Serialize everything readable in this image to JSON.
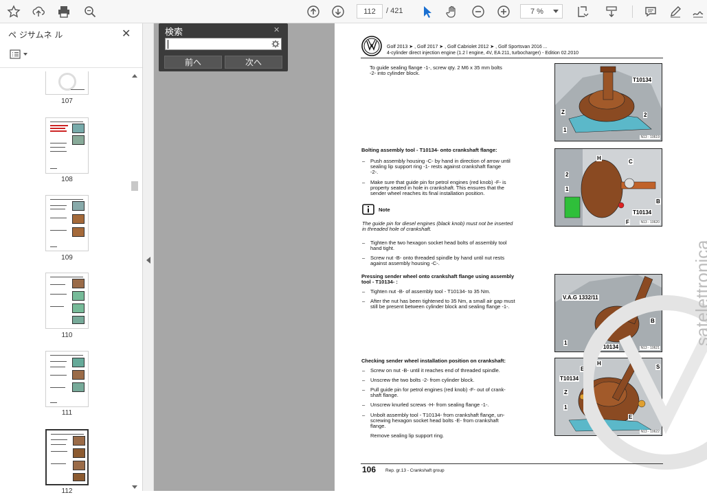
{
  "toolbar": {
    "page_current": "112",
    "page_total": "/ 421",
    "zoom": "7 %"
  },
  "sidebar": {
    "title": "ペ ジサムネ ル",
    "thumbnails": [
      {
        "label": "107"
      },
      {
        "label": "108"
      },
      {
        "label": "109"
      },
      {
        "label": "110"
      },
      {
        "label": "111"
      },
      {
        "label": "112"
      }
    ]
  },
  "search": {
    "title": "検索",
    "prev_label": "前へ",
    "next_label": "次へ",
    "input_value": ""
  },
  "document": {
    "header_line1": "Golf 2013 ➤ , Golf 2017 ➤ , Golf Cabriolet 2012 ➤ , Golf Sportsvan 2016 ...",
    "header_line2": "4-cylinder direct injection engine (1.2 l engine, 4V, EA 211, turbocharger) - Edition 02.2010",
    "s1_line1": "To guide sealing flange -1-, screw qty. 2 M6 x 35 mm bolts",
    "s1_line2": "-2- into cylinder block.",
    "s2_heading": "Bolting assembly tool - T10134- onto crankshaft flange:",
    "s2_b1_l1": "Push assembly housing -C- by hand in direction of arrow until",
    "s2_b1_l2": "sealing lip support ring -1- rests against crankshaft flange",
    "s2_b1_l3": "-2-.",
    "s2_b2_l1": "Make sure that guide pin for petrol engines (red knob) -F- is",
    "s2_b2_l2": "property seated in hole in crankshaft. This ensures that the",
    "s2_b2_l3": "sender wheel reaches its final installation position.",
    "note_label": "Note",
    "note_l1": "The guide pin for diesel engines (black knob) must not be inserted",
    "note_l2": "in threaded hole of crankshaft.",
    "s2_b3_l1": "Tighten the two hexagon socket head bolts of assembly tool",
    "s2_b3_l2": "hand tight.",
    "s2_b4_l1": "Screw nut -B- onto threaded spindle by hand until nut rests",
    "s2_b4_l2": "against assembly housing -C-.",
    "s3_heading_l1": "Pressing sender wheel onto crankshaft flange using assembly",
    "s3_heading_l2": "tool - T10134- :",
    "s3_b1": "Tighten nut -B- of assembly tool - T10134- to 35 Nm.",
    "s3_b2_l1": "After the nut has been tightened to 35 Nm, a small air gap must",
    "s3_b2_l2": "still be present between cylinder block and sealing flange -1-.",
    "s4_heading": "Checking sender wheel installation position on crankshaft:",
    "s4_b1": "Screw on nut -B- until it reaches end of threaded spindle.",
    "s4_b2": "Unscrew the two bolts -2- from cylinder block.",
    "s4_b3_l1": "Pull guide pin for petrol engines (red knob) -F- out of crank-",
    "s4_b3_l2": "shaft flange.",
    "s4_b4": "Unscrew knurled screws -H- from sealing flange -1-.",
    "s4_b5_l1": "Unbolt assembly tool - T10134- from crankshaft flange, un-",
    "s4_b5_l2": "screwing hexagon socket head bolts -E- from crankshaft",
    "s4_b5_l3": "flange.",
    "s4_b6": "Remove sealing lip support ring.",
    "page_number": "106",
    "page_footer": "Rep. gr.13 - Crankshaft group",
    "watermark": "satelettronica",
    "figures": [
      {
        "tool": "T10134",
        "labels": [
          "Z",
          "1",
          "2"
        ],
        "ref": "N13 - 10619"
      },
      {
        "tool": "T10134",
        "labels": [
          "H",
          "C",
          "2",
          "1",
          "B",
          "F"
        ],
        "ref": "N13 - 10620"
      },
      {
        "tool": "T10134",
        "vas": "V.A.G 1332/11",
        "labels": [
          "B",
          "1"
        ],
        "ref": "N13 - 10621"
      },
      {
        "tool": "T10134",
        "labels": [
          "H",
          "E",
          "S",
          "H",
          "Z",
          "1",
          "2",
          "E"
        ],
        "ref": "N13 - 10622"
      }
    ]
  }
}
